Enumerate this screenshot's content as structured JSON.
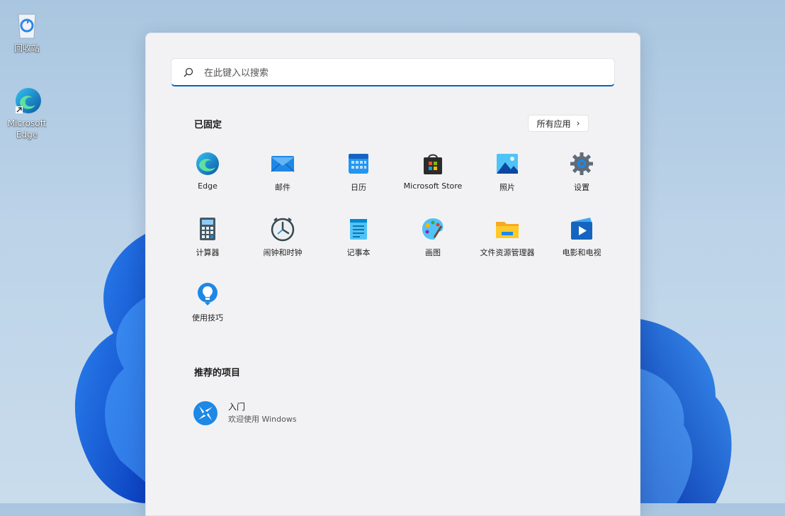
{
  "desktop": {
    "icons": [
      {
        "label": "回收站",
        "icon": "recycle-bin-icon"
      },
      {
        "label": "Microsoft Edge",
        "icon": "edge-icon"
      }
    ]
  },
  "start_menu": {
    "search": {
      "placeholder": "在此键入以搜索"
    },
    "pinned": {
      "title": "已固定",
      "all_apps_label": "所有应用",
      "apps": [
        {
          "label": "Edge",
          "icon": "edge-icon"
        },
        {
          "label": "邮件",
          "icon": "mail-icon"
        },
        {
          "label": "日历",
          "icon": "calendar-icon"
        },
        {
          "label": "Microsoft Store",
          "icon": "store-icon"
        },
        {
          "label": "照片",
          "icon": "photos-icon"
        },
        {
          "label": "设置",
          "icon": "gear-icon"
        },
        {
          "label": "计算器",
          "icon": "calculator-icon"
        },
        {
          "label": "闹钟和时钟",
          "icon": "clock-icon"
        },
        {
          "label": "记事本",
          "icon": "notepad-icon"
        },
        {
          "label": "画图",
          "icon": "paint-icon"
        },
        {
          "label": "文件资源管理器",
          "icon": "folder-icon"
        },
        {
          "label": "电影和电视",
          "icon": "movies-icon"
        },
        {
          "label": "使用技巧",
          "icon": "tips-icon"
        }
      ]
    },
    "recommended": {
      "title": "推荐的项目",
      "items": [
        {
          "title": "入门",
          "subtitle": "欢迎使用 Windows",
          "icon": "get-started-icon"
        }
      ]
    }
  },
  "colors": {
    "accent": "#0067c0",
    "wallpaper_bloom": "#1a5fe0"
  }
}
